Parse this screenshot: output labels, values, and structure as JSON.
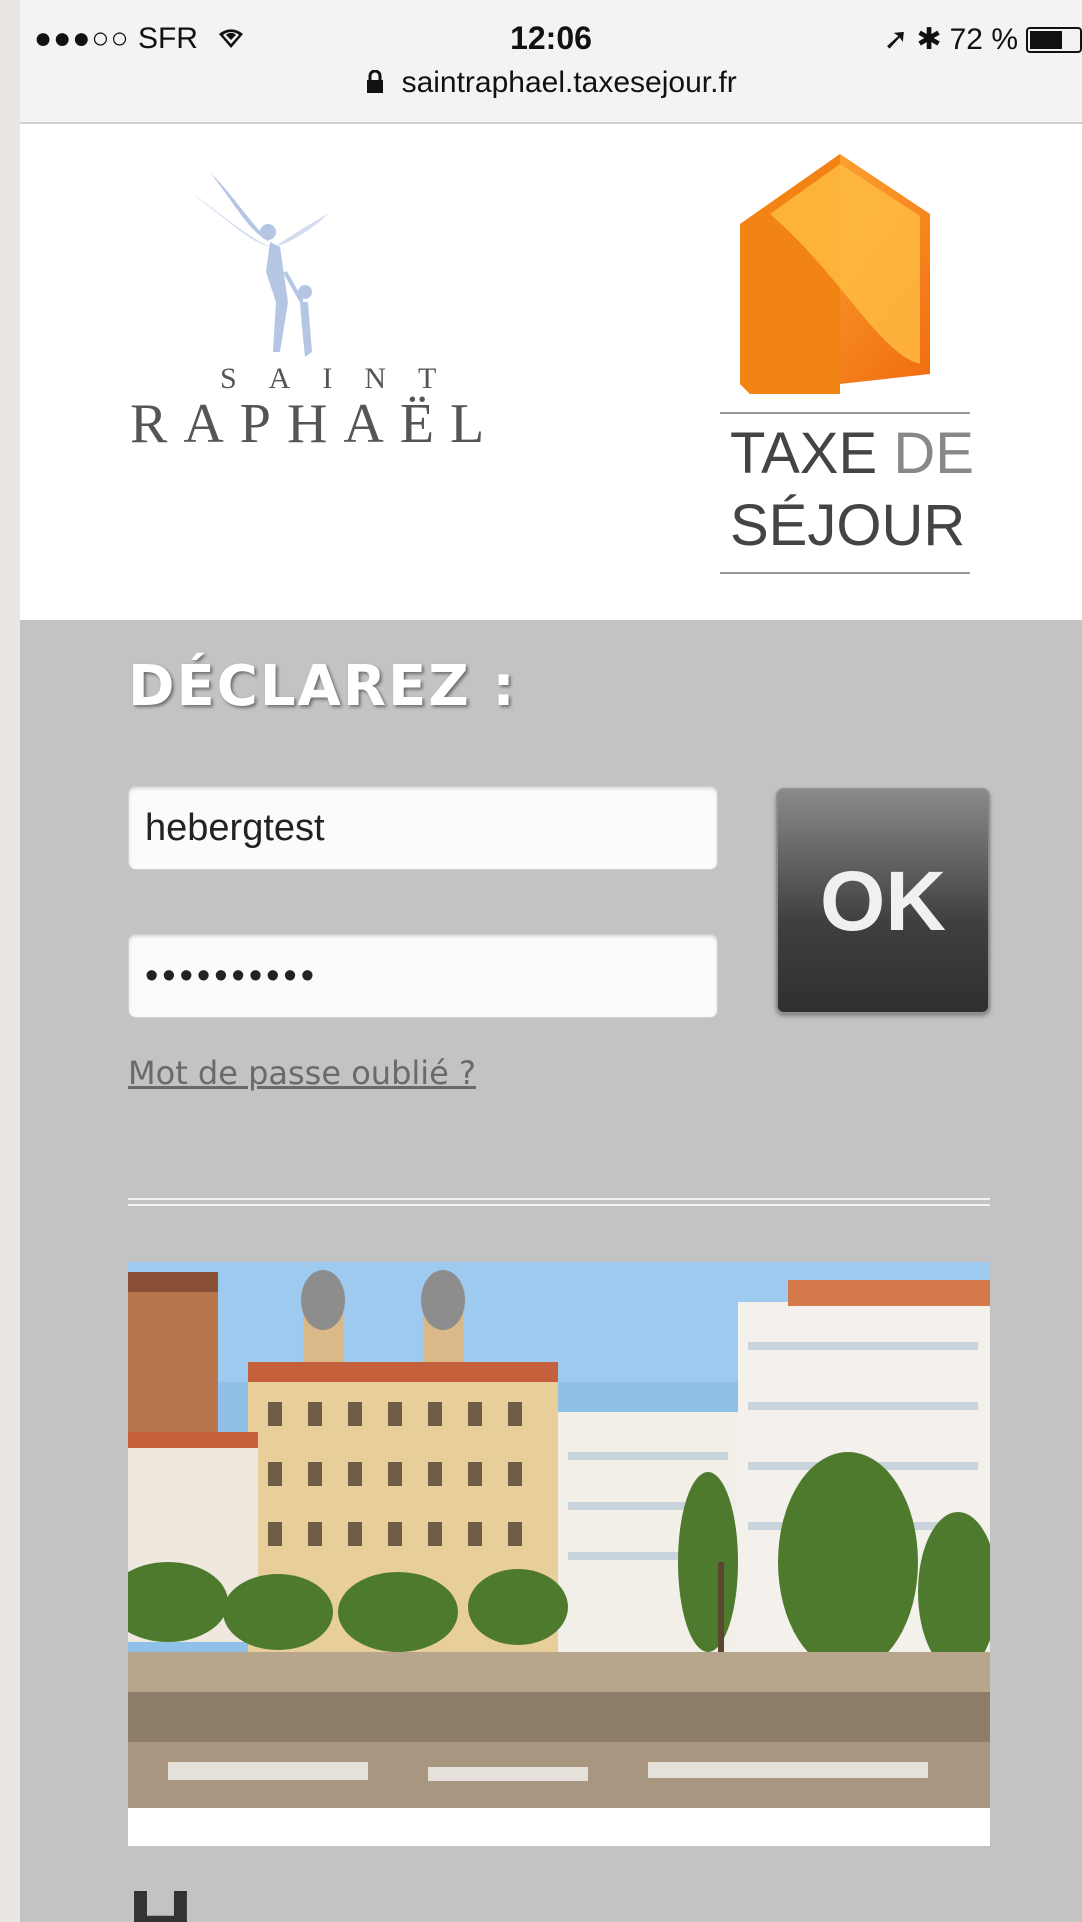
{
  "status_bar": {
    "carrier": "SFR",
    "signal_dots": "●●●○○",
    "time": "12:06",
    "battery_percent": "72 %",
    "battery_level": 0.72
  },
  "url_bar": {
    "domain": "saintraphael.taxesejour.fr"
  },
  "logos": {
    "city_saint": "SAINT",
    "city_raphael": "RAPHAËL",
    "taxe_line1_bold": "TAXE",
    "taxe_line1_light": "DE",
    "taxe_line2": "SÉJOUR",
    "brand_orange": "#f39019"
  },
  "form": {
    "title": "DÉCLAREZ :",
    "username_value": "hebergtest",
    "password_value": "••••••••••",
    "ok_label": "OK",
    "forgot_link": "Mot de passe oublié ?"
  },
  "next_section": {
    "heading_fragment": "H"
  }
}
